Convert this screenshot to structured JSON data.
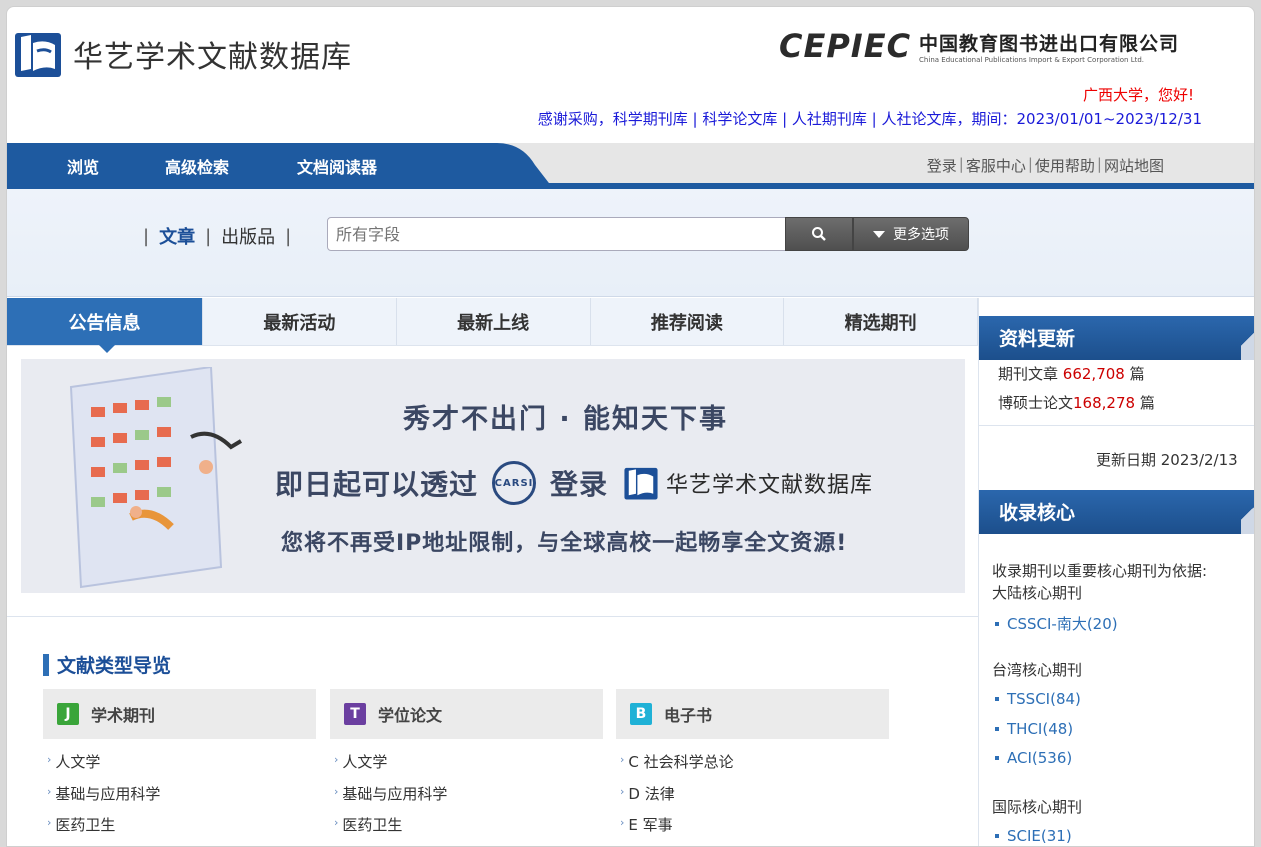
{
  "header": {
    "logo_text": "华艺学术文献数据库",
    "cepiec_word": "CEPIEC",
    "cepiec_cn": "中国教育图书进出口有限公司",
    "cepiec_en": "China Educational Publications Import & Export Corporation Ltd.",
    "greeting": "广西大学，您好!",
    "purchase": "感谢采购，科学期刊库 | 科学论文库 | 人社期刊库 | 人社论文库，期间：2023/01/01~2023/12/31"
  },
  "nav": {
    "items": [
      "浏览",
      "高级检索",
      "文档阅读器"
    ],
    "right": [
      "登录",
      "客服中心",
      "使用帮助",
      "网站地图"
    ]
  },
  "search": {
    "scope_article": "文章",
    "scope_publication": "出版品",
    "placeholder": "所有字段",
    "more_label": "更多选项"
  },
  "tabs": [
    "公告信息",
    "最新活动",
    "最新上线",
    "推荐阅读",
    "精选期刊"
  ],
  "banner": {
    "line1": "秀才不出门 · 能知天下事",
    "line2_a": "即日起可以透过",
    "carsi": "CARSI",
    "line2_b": "登录",
    "line2_logo": "华艺学术文献数据库",
    "line3": "您将不再受IP地址限制，与全球高校一起畅享全文资源!"
  },
  "doc_nav": {
    "title": "文献类型导览",
    "categories": [
      {
        "badge": "J",
        "label": "学术期刊",
        "color": "#3aa53a",
        "items": [
          "人文学",
          "基础与应用科学",
          "医药卫生"
        ]
      },
      {
        "badge": "T",
        "label": "学位论文",
        "color": "#6b3fa0",
        "items": [
          "人文学",
          "基础与应用科学",
          "医药卫生"
        ]
      },
      {
        "badge": "B",
        "label": "电子书",
        "color": "#1fb1d6",
        "items": [
          "C 社会科学总论",
          "D 法律",
          "E 军事"
        ]
      }
    ]
  },
  "updates": {
    "title": "资料更新",
    "journal_label": "期刊文章",
    "journal_count": "662,708",
    "journal_unit": "篇",
    "thesis_label": "博硕士论文",
    "thesis_count": "168,278",
    "thesis_unit": "篇",
    "date": "更新日期 2023/2/13"
  },
  "core": {
    "title": "收录核心",
    "intro": "收录期刊以重要核心期刊为依据:",
    "mainland": "大陆核心期刊",
    "mainland_items": [
      "CSSCI-南大(20)"
    ],
    "taiwan": "台湾核心期刊",
    "taiwan_items": [
      "TSSCI(84)",
      "THCI(48)",
      "ACI(536)"
    ],
    "intl": "国际核心期刊",
    "intl_items": [
      "SCIE(31)"
    ]
  }
}
